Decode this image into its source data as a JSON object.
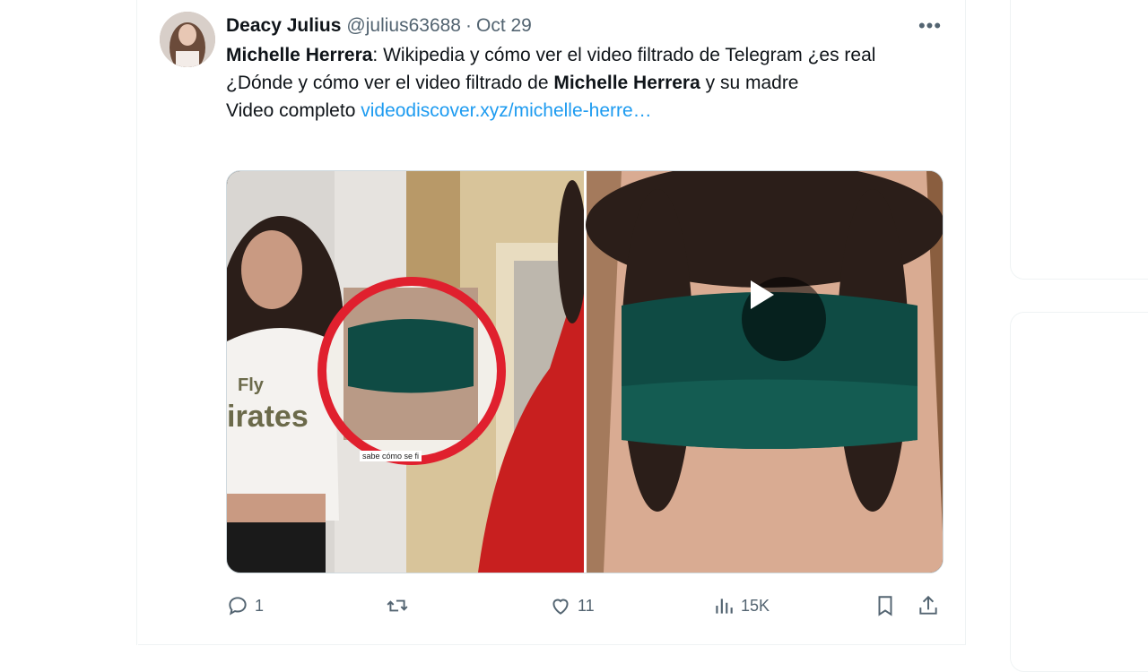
{
  "tweet": {
    "author_name": "Deacy Julius",
    "handle": "@julius63688",
    "separator": "·",
    "date": "Oct 29",
    "more_label": "•••",
    "line1_bold": "Michelle Herrera",
    "line1_rest": ": Wikipedia y cómo ver el video filtrado de Telegram ¿es real",
    "line2_prefix": "¿Dónde y cómo ver el video filtrado de ",
    "line2_bold": "Michelle Herrera",
    "line2_suffix": " y su madre",
    "line3_prefix": "Video completo ",
    "line3_link": "videodiscover.xyz/michelle-herre…",
    "media_caption": "sabe cómo se fi",
    "shirt_text_1": "Fly",
    "shirt_text_2": "irates"
  },
  "actions": {
    "reply_count": "1",
    "retweet_count": "",
    "like_count": "11",
    "views_count": "15K"
  },
  "colors": {
    "link": "#1d9bf0",
    "muted": "#536471",
    "border": "#cfd9de",
    "highlight_circle": "#e0202e"
  }
}
